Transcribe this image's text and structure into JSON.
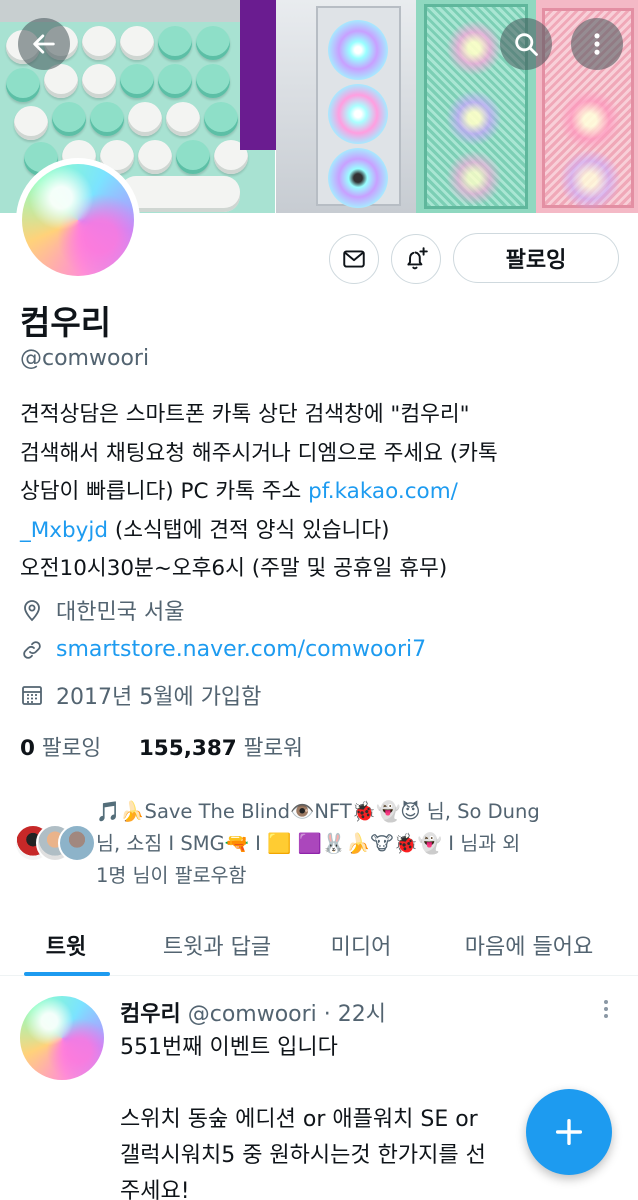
{
  "profile": {
    "name": "컴우리",
    "handle": "@comwoori",
    "bio": {
      "line1": "견적상담은 스마트폰 카톡 상단 검색창에 \"컴우리\"",
      "line2": "검색해서 채팅요청 해주시거나 디엠으로 주세요 (카톡",
      "line3_prefix": "상담이 빠릅니다) PC 카톡 주소 ",
      "link_part1": "pf.kakao.com/",
      "link_part2": "_Mxbyjd",
      "line4_suffix": " (소식탭에 견적 양식 있습니다)",
      "line5": "오전10시30분~오후6시 (주말 및 공휴일 휴무)"
    },
    "location": "대한민국 서울",
    "website": "smartstore.naver.com/comwoori7",
    "joined": "2017년 5월에 가입함",
    "following_count": "0",
    "following_label": "팔로잉",
    "followers_count": "155,387",
    "followers_label": "팔로워",
    "follow_button": "팔로잉",
    "followers_you_know": {
      "line1": "🎵🍌Save The Blind👁️NFT🐞👻😈 님, So Dung",
      "line2": "님, 소짐 I SMG🔫 I 🟨 🟪🐰🍌🐮🐞👻 I 님과 외",
      "line3": "1명 님이 팔로우함"
    }
  },
  "tabs": [
    {
      "label": "트윗",
      "active": true
    },
    {
      "label": "트윗과 답글",
      "active": false
    },
    {
      "label": "미디어",
      "active": false
    },
    {
      "label": "마음에 들어요",
      "active": false
    }
  ],
  "tweet": {
    "name": "컴우리",
    "handle": "@comwoori",
    "separator": "·",
    "time": "22시",
    "text": "551번째 이벤트 입니다\n\n스위치 동숲 에디션 or 애플워치 SE or\n갤럭시워치5 중 원하시는것 한가지를 선\n주세요!"
  },
  "icons": {
    "back": "back-arrow-icon",
    "search": "search-icon",
    "more": "more-vertical-icon",
    "message": "envelope-icon",
    "notify": "bell-plus-icon",
    "location": "location-pin-icon",
    "link": "link-icon",
    "calendar": "calendar-icon",
    "compose": "plus-icon"
  },
  "colors": {
    "accent": "#1d9bf0",
    "text": "#0f1419",
    "muted": "#536471"
  }
}
